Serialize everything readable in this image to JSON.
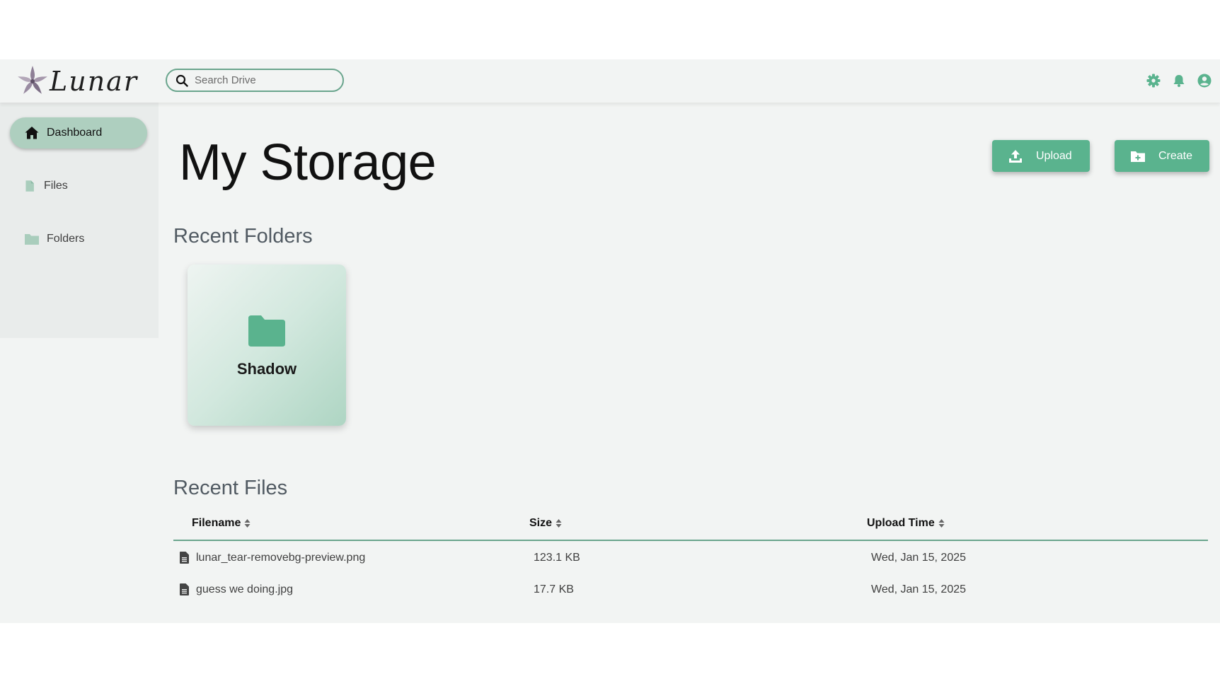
{
  "app": {
    "name": "Lunar"
  },
  "search": {
    "placeholder": "Search Drive"
  },
  "header_icons": [
    "gear-icon",
    "bell-icon",
    "user-circle-icon"
  ],
  "sidebar": {
    "items": [
      {
        "label": "Dashboard",
        "icon": "home-icon",
        "active": true
      },
      {
        "label": "Files",
        "icon": "file-icon",
        "active": false
      },
      {
        "label": "Folders",
        "icon": "folder-icon",
        "active": false
      }
    ]
  },
  "main": {
    "title": "My Storage",
    "upload_label": "Upload",
    "create_label": "Create",
    "recent_folders_title": "Recent Folders",
    "recent_files_title": "Recent Files",
    "folders": [
      {
        "name": "Shadow"
      }
    ],
    "files_table": {
      "columns": [
        "Filename",
        "Size",
        "Upload Time"
      ],
      "rows": [
        {
          "filename": "lunar_tear-removebg-preview.png",
          "size": "123.1 KB",
          "upload_time": "Wed, Jan 15, 2025"
        },
        {
          "filename": "guess we doing.jpg",
          "size": "17.7 KB",
          "upload_time": "Wed, Jan 15, 2025"
        }
      ]
    }
  },
  "colors": {
    "accent": "#5ab38e",
    "accent_border": "#6aa58d",
    "active_nav": "#aecfbf",
    "page_bg": "#f2f4f3",
    "sidebar_bg": "#e9eceb"
  }
}
